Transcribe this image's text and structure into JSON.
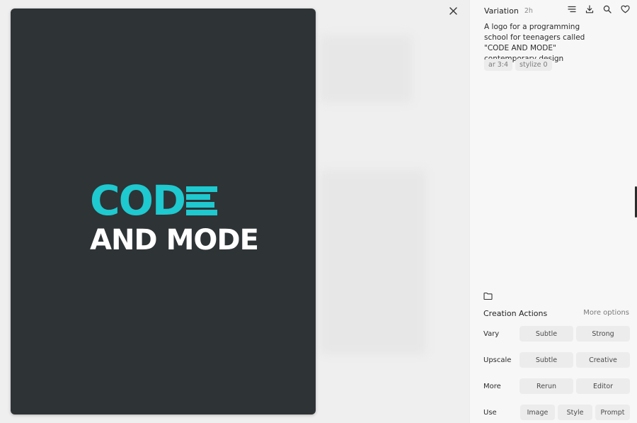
{
  "logo": {
    "line1": "COD",
    "line2": "AND MODE"
  },
  "header": {
    "title": "Variation",
    "time": "2h"
  },
  "prompt": "A logo for a programming school for teenagers called \"CODE AND MODE\" contemporary design",
  "tags": [
    "ar 3:4",
    "stylize 0"
  ],
  "actions": {
    "title": "Creation Actions",
    "more_options": "More options",
    "rows": [
      {
        "label": "Vary",
        "buttons": [
          "Subtle",
          "Strong"
        ]
      },
      {
        "label": "Upscale",
        "buttons": [
          "Subtle",
          "Creative"
        ]
      },
      {
        "label": "More",
        "buttons": [
          "Rerun",
          "Editor"
        ]
      },
      {
        "label": "Use",
        "buttons": [
          "Image",
          "Style",
          "Prompt"
        ]
      }
    ]
  },
  "icons": {
    "close": "close-icon",
    "options": "options-icon",
    "download": "download-icon",
    "search": "search-icon",
    "like": "heart-icon",
    "folder": "folder-icon"
  },
  "colors": {
    "logo_accent": "#1ec9cf",
    "image_background": "#2e3336"
  }
}
